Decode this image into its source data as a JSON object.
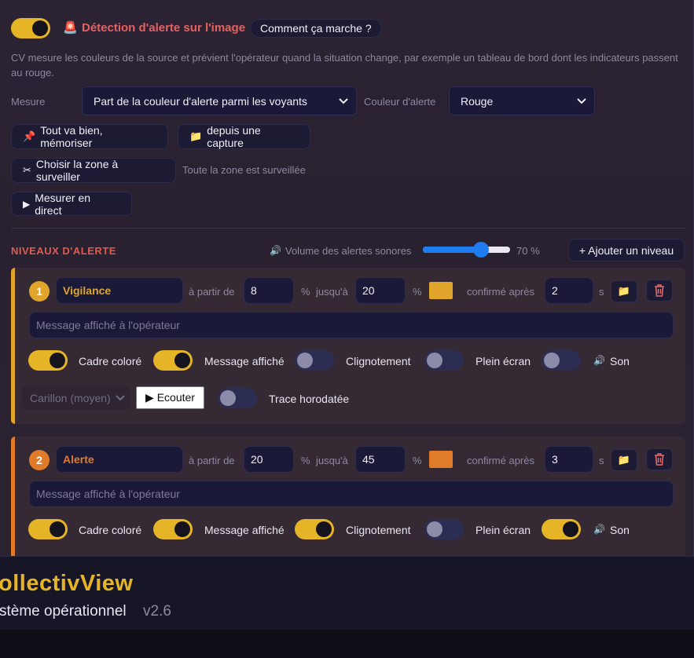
{
  "detector": {
    "enabled": true,
    "icon": "siren-icon",
    "title": "Détection d'alerte sur l'image",
    "how_button": "Comment ça marche ?",
    "description": "CV mesure les couleurs de la source et prévient l'opérateur quand la situation change, par exemple un tableau de bord dont les indicateurs passent au rouge.",
    "measure_label": "Mesure",
    "measure_value": "Part de la couleur d'alerte parmi les voyants",
    "alert_color_label": "Couleur d'alerte",
    "alert_color_value": "Rouge",
    "memorize_button": "Tout va bien, mémoriser",
    "memorize_icon": "pushpin-icon",
    "capture_button": "depuis une capture",
    "capture_icon": "folder-icon",
    "zone_button": "Choisir la zone à surveiller",
    "zone_icon": "scissors-icon",
    "zone_status": "Toute la zone est surveillée",
    "live_button": "Mesurer en direct",
    "live_icon": "play-icon"
  },
  "levels_header": {
    "title": "NIVEAUX D'ALERTE",
    "volume_icon": "speaker-icon",
    "volume_label": "Volume des alertes sonores",
    "volume_percent": 70,
    "volume_text": "70 %",
    "add_button": "+ Ajouter un niveau"
  },
  "common": {
    "from_label": "à partir de",
    "percent": "%",
    "to_label": "jusqu'à",
    "confirm_label": "confirmé après",
    "seconds": "s",
    "message_placeholder": "Message affiché à l'opérateur",
    "opt_frame": "Cadre coloré",
    "opt_message": "Message affiché",
    "opt_blink": "Clignotement",
    "opt_fullscreen": "Plein écran",
    "opt_sound": "Son",
    "listen_button": "▶ Ecouter",
    "trace_label": "Trace horodatée"
  },
  "levels": [
    {
      "number": "1",
      "name": "Vigilance",
      "from": "8",
      "to": "20",
      "color": "#e0a52a",
      "confirm": "2",
      "frame": true,
      "message": true,
      "blink": false,
      "fullscreen": false,
      "sound": false,
      "sound_choice": "Carillon (moyen)",
      "trace": false
    },
    {
      "number": "2",
      "name": "Alerte",
      "from": "20",
      "to": "45",
      "color": "#e07b2a",
      "confirm": "3",
      "frame": true,
      "message": true,
      "blink": true,
      "fullscreen": false,
      "sound": true
    }
  ],
  "footer": {
    "brand": "ollectivView",
    "subtitle": "stème opérationnel",
    "version": "v2.6"
  },
  "colors": {
    "accent_yellow": "#e6b527",
    "alert_red": "#e05a5a",
    "level1": "#e0a52a",
    "level2": "#e07b2a"
  }
}
